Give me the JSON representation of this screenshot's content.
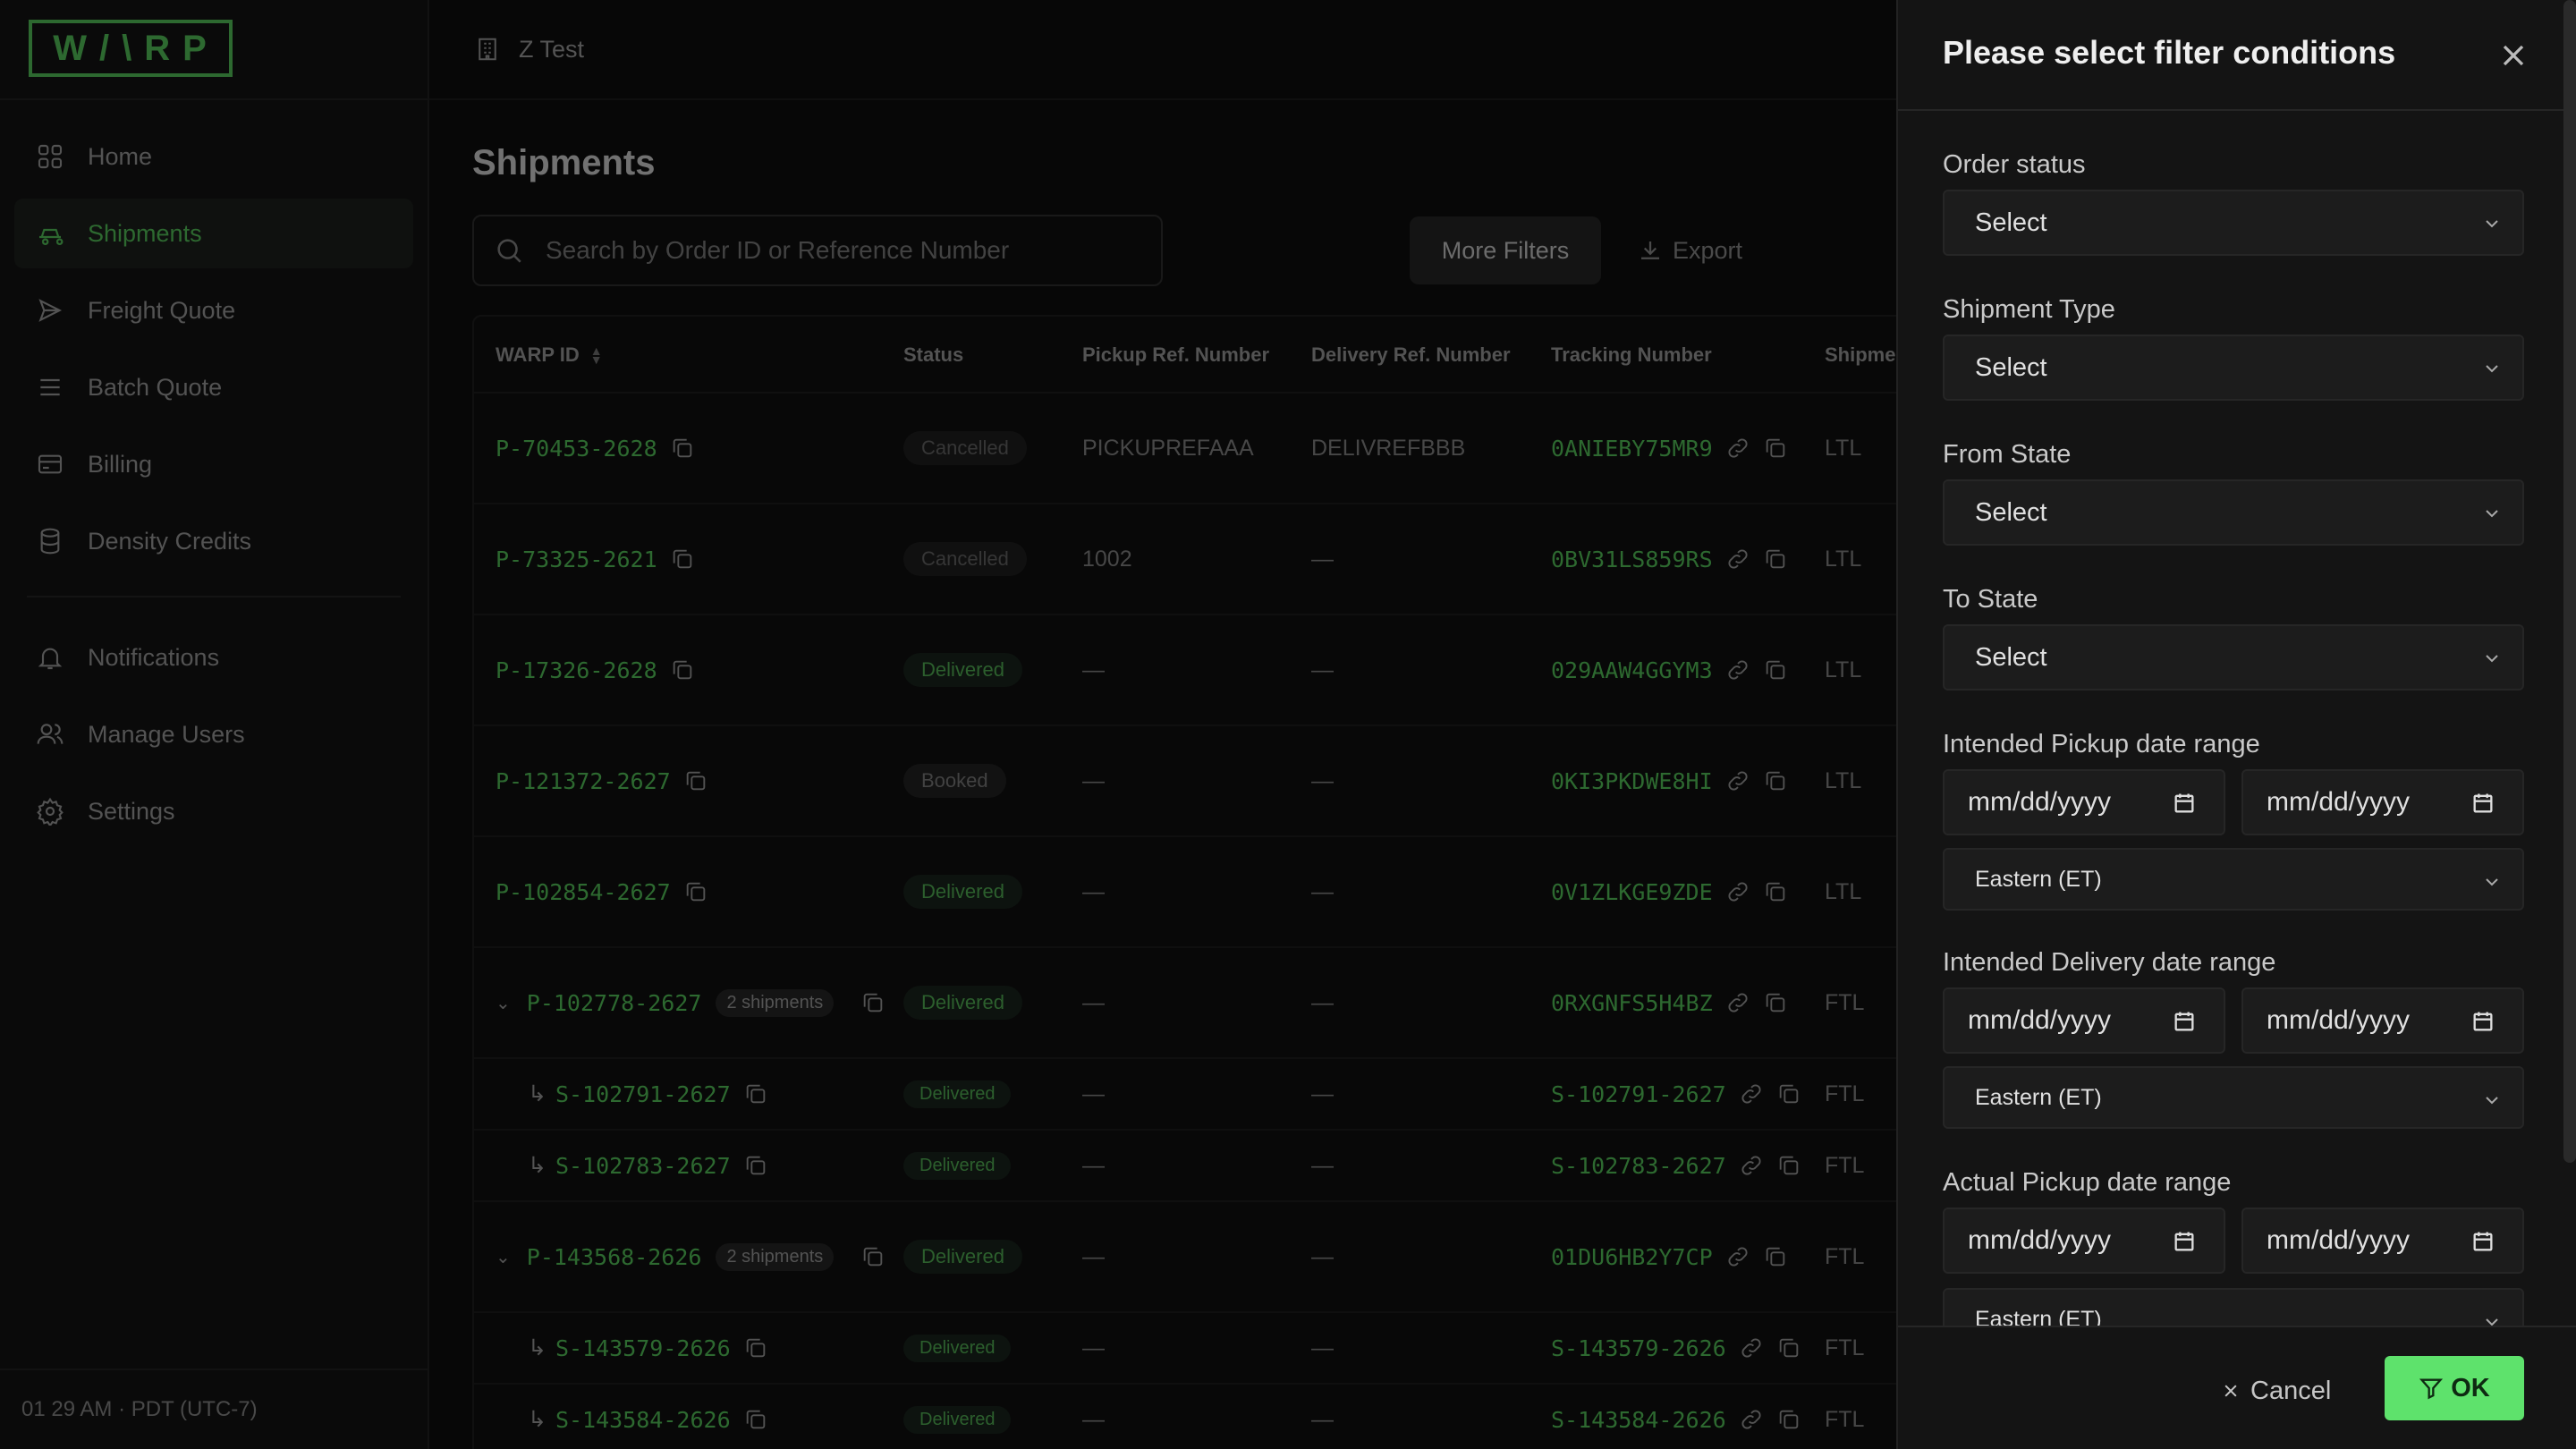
{
  "brand": {
    "logo_text": "W/\\RP",
    "accent": "#4caf50"
  },
  "sidebar": {
    "items": [
      {
        "label": "Home",
        "icon": "grid-icon"
      },
      {
        "label": "Shipments",
        "icon": "truck-icon",
        "active": true
      },
      {
        "label": "Freight Quote",
        "icon": "send-icon"
      },
      {
        "label": "Batch Quote",
        "icon": "list-icon"
      },
      {
        "label": "Billing",
        "icon": "card-icon"
      },
      {
        "label": "Density Credits",
        "icon": "database-icon"
      }
    ],
    "secondary_items": [
      {
        "label": "Notifications",
        "icon": "bell-icon"
      },
      {
        "label": "Manage Users",
        "icon": "users-icon"
      },
      {
        "label": "Settings",
        "icon": "gear-icon"
      }
    ],
    "footer_time": "01 29 AM · PDT (UTC-7)"
  },
  "topbar": {
    "org": "Z Test"
  },
  "main": {
    "title": "Shipments",
    "search_placeholder": "Search by Order ID or Reference Number",
    "more_filters": "More Filters",
    "export": "Export",
    "columns": [
      "WARP ID",
      "Status",
      "Pickup Ref. Number",
      "Delivery Ref. Number",
      "Tracking Number",
      "Shipme"
    ],
    "rows": [
      {
        "id": "P-70453-2628",
        "status": "Cancelled",
        "status_kind": "cancelled",
        "pickup": "PICKUPREFAAA",
        "delivery": "DELIVREFBBB",
        "tracking": "0ANIEBY75MR9",
        "type": "LTL"
      },
      {
        "id": "P-73325-2621",
        "status": "Cancelled",
        "status_kind": "cancelled",
        "pickup": "1002",
        "delivery": "—",
        "tracking": "0BV31LS859RS",
        "type": "LTL"
      },
      {
        "id": "P-17326-2628",
        "status": "Delivered",
        "status_kind": "delivered",
        "pickup": "—",
        "delivery": "—",
        "tracking": "029AAW4GGYM3",
        "type": "LTL"
      },
      {
        "id": "P-121372-2627",
        "status": "Booked",
        "status_kind": "booked",
        "pickup": "—",
        "delivery": "—",
        "tracking": "0KI3PKDWE8HI",
        "type": "LTL"
      },
      {
        "id": "P-102854-2627",
        "status": "Delivered",
        "status_kind": "delivered",
        "pickup": "—",
        "delivery": "—",
        "tracking": "0V1ZLKGE9ZDE",
        "type": "LTL"
      },
      {
        "id": "P-102778-2627",
        "group": true,
        "count_label": "2 shipments",
        "status": "Delivered",
        "status_kind": "delivered",
        "pickup": "—",
        "delivery": "—",
        "tracking": "0RXGNFS5H4BZ",
        "type": "FTL"
      },
      {
        "id": "S-102791-2627",
        "child": true,
        "status": "Delivered",
        "status_kind": "delivered",
        "pickup": "—",
        "delivery": "—",
        "tracking": "S-102791-2627",
        "type": "FTL"
      },
      {
        "id": "S-102783-2627",
        "child": true,
        "status": "Delivered",
        "status_kind": "delivered",
        "pickup": "—",
        "delivery": "—",
        "tracking": "S-102783-2627",
        "type": "FTL"
      },
      {
        "id": "P-143568-2626",
        "group": true,
        "count_label": "2 shipments",
        "status": "Delivered",
        "status_kind": "delivered",
        "pickup": "—",
        "delivery": "—",
        "tracking": "01DU6HB2Y7CP",
        "type": "FTL"
      },
      {
        "id": "S-143579-2626",
        "child": true,
        "status": "Delivered",
        "status_kind": "delivered",
        "pickup": "—",
        "delivery": "—",
        "tracking": "S-143579-2626",
        "type": "FTL"
      },
      {
        "id": "S-143584-2626",
        "child": true,
        "status": "Delivered",
        "status_kind": "delivered",
        "pickup": "—",
        "delivery": "—",
        "tracking": "S-143584-2626",
        "type": "FTL"
      }
    ]
  },
  "drawer": {
    "title": "Please select filter conditions",
    "order_status": {
      "label": "Order status",
      "value": "Select"
    },
    "shipment_type": {
      "label": "Shipment Type",
      "value": "Select"
    },
    "from_state": {
      "label": "From State",
      "value": "Select"
    },
    "to_state": {
      "label": "To State",
      "value": "Select"
    },
    "pickup_range": {
      "label": "Intended Pickup date range",
      "from": "mm/dd/yyyy",
      "to": "mm/dd/yyyy",
      "tz": "Eastern (ET)"
    },
    "delivery_range": {
      "label": "Intended Delivery date range",
      "from": "mm/dd/yyyy",
      "to": "mm/dd/yyyy",
      "tz": "Eastern (ET)"
    },
    "actual_pickup_range": {
      "label": "Actual Pickup date range",
      "from": "mm/dd/yyyy",
      "to": "mm/dd/yyyy",
      "tz": "Eastern (ET)"
    },
    "cancel": "Cancel",
    "ok": "OK",
    "ok_color": "#5ee26c"
  }
}
